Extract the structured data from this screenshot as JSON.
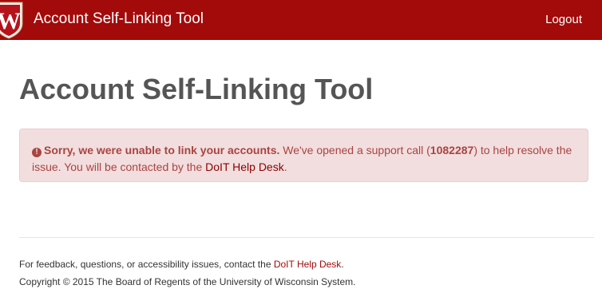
{
  "header": {
    "brand": "Account Self-Linking Tool",
    "logout_label": "Logout",
    "crest_letter": "W",
    "brand_color": "#a30a0a"
  },
  "main": {
    "title": "Account Self-Linking Tool",
    "alert": {
      "icon": "exclamation-circle-icon",
      "icon_glyph": "!",
      "bold_text": "Sorry, we were unable to link your accounts.",
      "text_before_ticket": " We've opened a support call (",
      "ticket_number": "1082287",
      "text_after_ticket": ") to help resolve the issue. You will be contacted by the ",
      "link_text": "DoIT Help Desk",
      "text_end": "."
    }
  },
  "footer": {
    "feedback_prefix": "For feedback, questions, or accessibility issues, contact the ",
    "feedback_link": "DoIT Help Desk",
    "feedback_suffix": ".",
    "copyright": "Copyright © 2015 The Board of Regents of the University of Wisconsin System."
  }
}
